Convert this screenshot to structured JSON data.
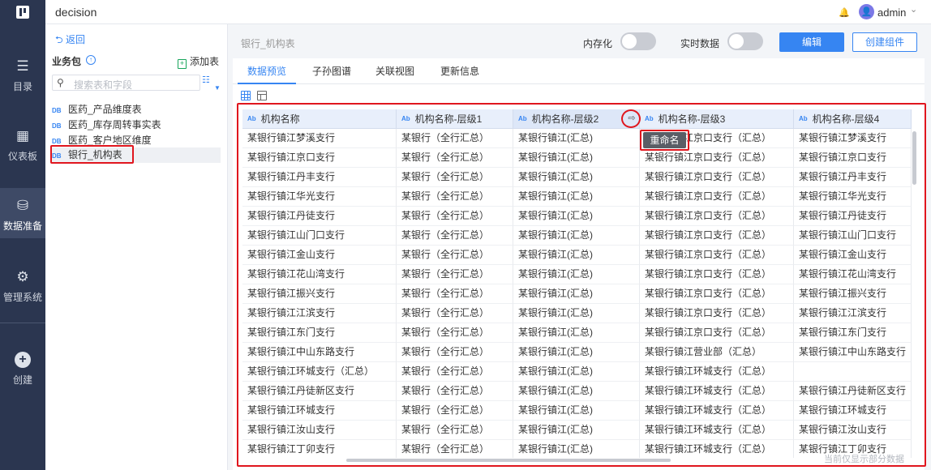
{
  "app": {
    "title": "decision",
    "user": "admin",
    "avatar_glyph": "👤"
  },
  "nav": [
    {
      "id": "catalog",
      "label": "目录",
      "icon": "list-icon",
      "glyph": "☰"
    },
    {
      "id": "dashboard",
      "label": "仪表板",
      "icon": "dashboard-icon",
      "glyph": "▦"
    },
    {
      "id": "data-prep",
      "label": "数据准备",
      "icon": "database-icon",
      "glyph": "⛁"
    },
    {
      "id": "admin",
      "label": "管理系统",
      "icon": "gear-icon",
      "glyph": "⚙"
    },
    {
      "id": "create",
      "label": "创建",
      "icon": "plus-icon",
      "glyph": "+"
    }
  ],
  "sidebar": {
    "back": "返回",
    "back_glyph": "⮌",
    "package_title": "业务包",
    "add_table": "添加表",
    "search_placeholder": "搜索表和字段",
    "tables": [
      {
        "label": "医药_产品维度表",
        "tag": "DB"
      },
      {
        "label": "医药_库存周转事实表",
        "tag": "DB"
      },
      {
        "label": "医药_客户地区维度",
        "tag": "DB"
      },
      {
        "label": "银行_机构表",
        "tag": "DB"
      }
    ]
  },
  "main": {
    "breadcrumb": "银行_机构表",
    "toggle_memory": "内存化",
    "toggle_realtime": "实时数据",
    "edit_button": "编辑",
    "create_button": "创建组件",
    "tabs": [
      "数据预览",
      "子孙图谱",
      "关联视图",
      "更新信息"
    ],
    "context_menu": "重命名",
    "drag_glyph": "⇨",
    "footnote": "当前仅显示部分数据"
  },
  "table": {
    "type_tag": "Ab",
    "headers": [
      "机构名称",
      "机构名称-层级1",
      "机构名称-层级2",
      "机构名称-层级3",
      "机构名称-层级4"
    ],
    "rows": [
      [
        "某银行镇江梦溪支行",
        "某银行（全行汇总）",
        "某银行镇江(汇总)",
        "某银行镇江京口支行（汇总）",
        "某银行镇江梦溪支行"
      ],
      [
        "某银行镇江京口支行",
        "某银行（全行汇总）",
        "某银行镇江(汇总)",
        "某银行镇江京口支行（汇总）",
        "某银行镇江京口支行"
      ],
      [
        "某银行镇江丹丰支行",
        "某银行（全行汇总）",
        "某银行镇江(汇总)",
        "某银行镇江京口支行（汇总）",
        "某银行镇江丹丰支行"
      ],
      [
        "某银行镇江华光支行",
        "某银行（全行汇总）",
        "某银行镇江(汇总)",
        "某银行镇江京口支行（汇总）",
        "某银行镇江华光支行"
      ],
      [
        "某银行镇江丹徒支行",
        "某银行（全行汇总）",
        "某银行镇江(汇总)",
        "某银行镇江京口支行（汇总）",
        "某银行镇江丹徒支行"
      ],
      [
        "某银行镇江山门口支行",
        "某银行（全行汇总）",
        "某银行镇江(汇总)",
        "某银行镇江京口支行（汇总）",
        "某银行镇江山门口支行"
      ],
      [
        "某银行镇江金山支行",
        "某银行（全行汇总）",
        "某银行镇江(汇总)",
        "某银行镇江京口支行（汇总）",
        "某银行镇江金山支行"
      ],
      [
        "某银行镇江花山湾支行",
        "某银行（全行汇总）",
        "某银行镇江(汇总)",
        "某银行镇江京口支行（汇总）",
        "某银行镇江花山湾支行"
      ],
      [
        "某银行镇江振兴支行",
        "某银行（全行汇总）",
        "某银行镇江(汇总)",
        "某银行镇江京口支行（汇总）",
        "某银行镇江振兴支行"
      ],
      [
        "某银行镇江江滨支行",
        "某银行（全行汇总）",
        "某银行镇江(汇总)",
        "某银行镇江京口支行（汇总）",
        "某银行镇江江滨支行"
      ],
      [
        "某银行镇江东门支行",
        "某银行（全行汇总）",
        "某银行镇江(汇总)",
        "某银行镇江京口支行（汇总）",
        "某银行镇江东门支行"
      ],
      [
        "某银行镇江中山东路支行",
        "某银行（全行汇总）",
        "某银行镇江(汇总)",
        "某银行镇江营业部（汇总）",
        "某银行镇江中山东路支行"
      ],
      [
        "某银行镇江环城支行（汇总）",
        "某银行（全行汇总）",
        "某银行镇江(汇总)",
        "某银行镇江环城支行（汇总）",
        ""
      ],
      [
        "某银行镇江丹徒新区支行",
        "某银行（全行汇总）",
        "某银行镇江(汇总)",
        "某银行镇江环城支行（汇总）",
        "某银行镇江丹徒新区支行"
      ],
      [
        "某银行镇江环城支行",
        "某银行（全行汇总）",
        "某银行镇江(汇总)",
        "某银行镇江环城支行（汇总）",
        "某银行镇江环城支行"
      ],
      [
        "某银行镇江汝山支行",
        "某银行（全行汇总）",
        "某银行镇江(汇总)",
        "某银行镇江环城支行（汇总）",
        "某银行镇江汝山支行"
      ],
      [
        "某银行镇江丁卯支行",
        "某银行（全行汇总）",
        "某银行镇江(汇总)",
        "某银行镇江环城支行（汇总）",
        "某银行镇江丁卯支行"
      ]
    ]
  },
  "colors": {
    "accent": "#3685f2",
    "nav_bg": "#2b3650",
    "highlight": "#e0161e"
  }
}
